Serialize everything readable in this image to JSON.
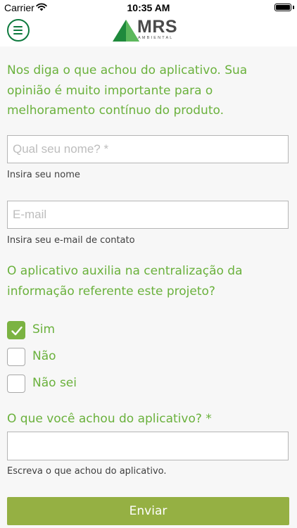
{
  "status_bar": {
    "carrier": "Carrier",
    "time": "10:35 AM",
    "wifi_icon": "wifi-icon",
    "battery_icon": "battery-icon"
  },
  "nav": {
    "menu_icon": "hamburger-menu-icon",
    "logo_text": "MRS",
    "logo_subtext": "AMBIENTAL",
    "brand_color": "#0e7a3e"
  },
  "intro": "Nos diga o que achou do aplicativo. Sua opinião é muito importante para o melhoramento contínuo do produto.",
  "name_field": {
    "placeholder": "Qual seu nome?  *",
    "value": "",
    "helper": "Insira seu nome"
  },
  "email_field": {
    "placeholder": "E-mail",
    "value": "",
    "helper": "Insira seu e-mail de contato"
  },
  "question1": "O aplicativo auxilia na centralização da informação referente este projeto?",
  "options": [
    {
      "label": "Sim",
      "checked": true
    },
    {
      "label": "Não",
      "checked": false
    },
    {
      "label": "Não sei",
      "checked": false
    }
  ],
  "question2": "O que você achou do aplicativo?  *",
  "feedback_field": {
    "value": "",
    "helper": "Escreva o que achou do aplicativo."
  },
  "submit_label": "Enviar",
  "colors": {
    "accent_green": "#6ab13c",
    "checkbox_green": "#7bb342",
    "button_green": "#95b043"
  }
}
